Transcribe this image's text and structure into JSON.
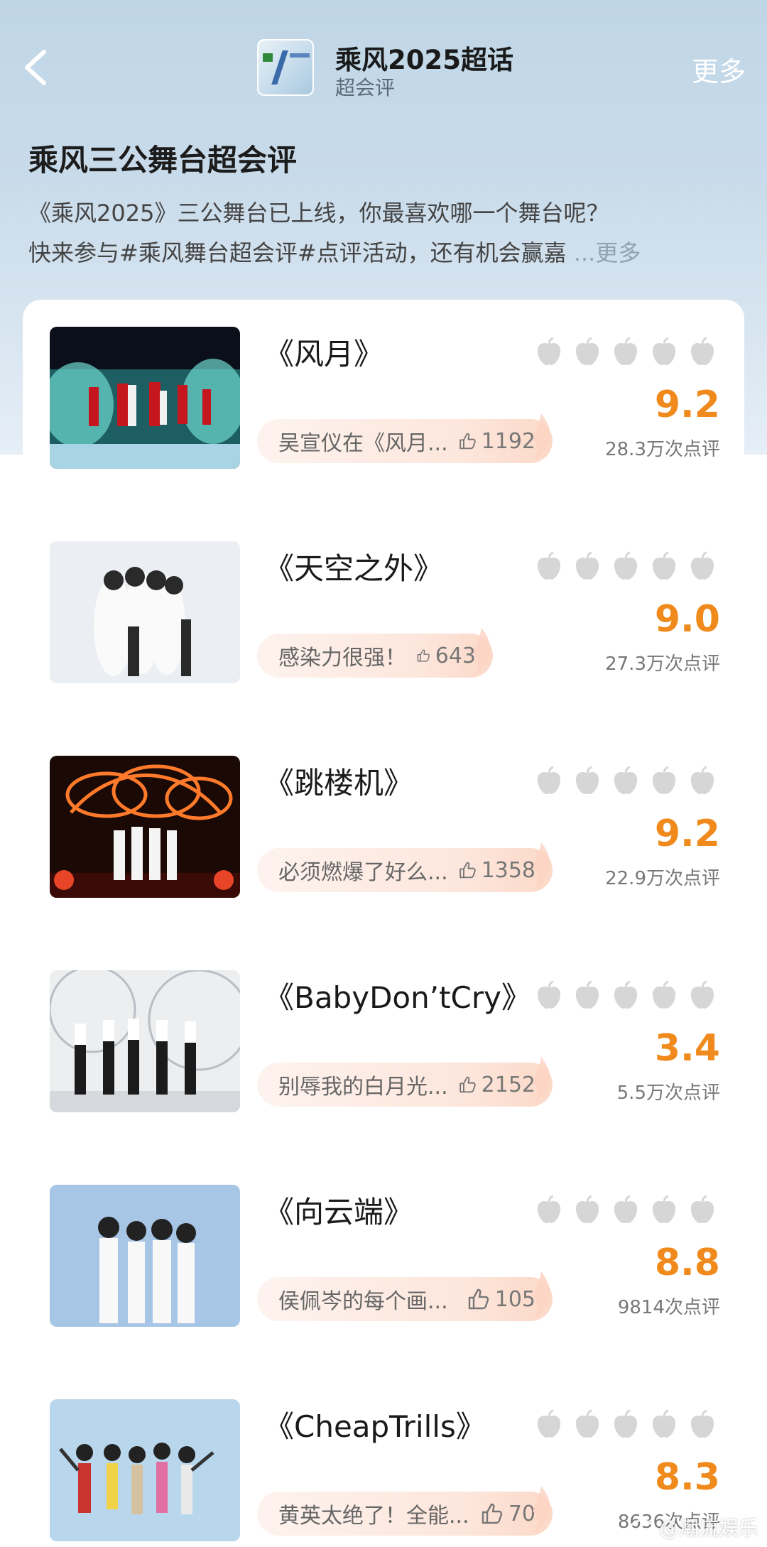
{
  "header": {
    "topic_title": "乘风2025超话",
    "topic_subtitle": "超会评",
    "more_label": "更多"
  },
  "page": {
    "title": "乘风三公舞台超会评",
    "description_line1": "《乘风2025》三公舞台已上线，你最喜欢哪一个舞台呢？",
    "description_line2": "快来参与#乘风舞台超会评#点评活动，还有机会赢嘉",
    "description_more": " ...更多"
  },
  "colors": {
    "accent_score": "#f08a1c",
    "apple_gray": "#d6d6d6"
  },
  "stages": [
    {
      "title": "《风月》",
      "rating_icons": 5,
      "score": "9.2",
      "review_count": "28.3万次点评",
      "comment": "吴宣仪在《风月...",
      "likes": "1192"
    },
    {
      "title": "《天空之外》",
      "rating_icons": 5,
      "score": "9.0",
      "review_count": "27.3万次点评",
      "comment": "感染力很强！",
      "likes": "643"
    },
    {
      "title": "《跳楼机》",
      "rating_icons": 5,
      "score": "9.2",
      "review_count": "22.9万次点评",
      "comment": "必须燃爆了好么...",
      "likes": "1358"
    },
    {
      "title": "《BabyDon’tCry》",
      "rating_icons": 5,
      "score": "3.4",
      "review_count": "5.5万次点评",
      "comment": "别辱我的白月光...",
      "likes": "2152"
    },
    {
      "title": "《向云端》",
      "rating_icons": 5,
      "score": "8.8",
      "review_count": "9814次点评",
      "comment": "侯佩岑的每个画...",
      "likes": "105"
    },
    {
      "title": "《CheapTrills》",
      "rating_icons": 5,
      "score": "8.3",
      "review_count": "8636次点评",
      "comment": "黄英太绝了！全能...",
      "likes": "70"
    }
  ],
  "watermark": "@潮流娱乐",
  "icons": {
    "back": "chevron-left-icon",
    "rating": "apple-icon",
    "like": "thumbs-up-icon"
  }
}
